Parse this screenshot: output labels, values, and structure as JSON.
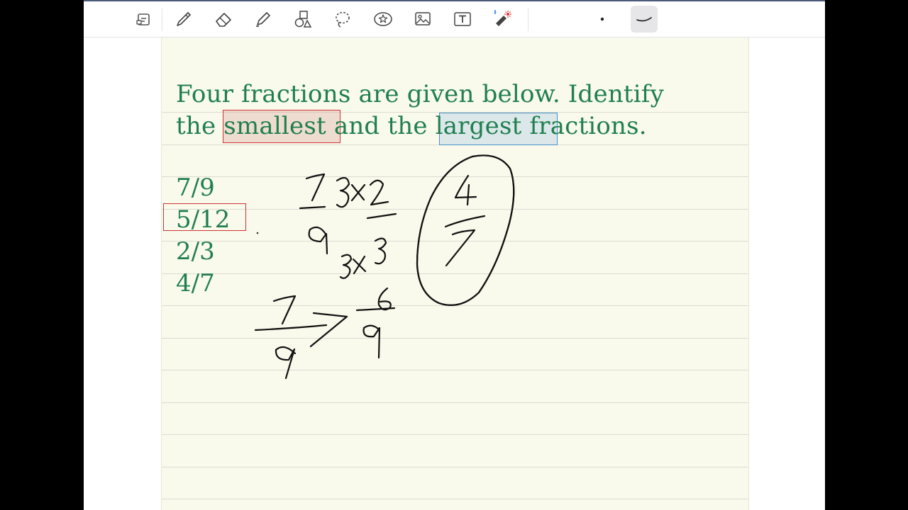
{
  "toolbar": {
    "tools": [
      {
        "name": "page-layout-icon",
        "label": "Page layout"
      },
      {
        "name": "pen-icon",
        "label": "Pen"
      },
      {
        "name": "eraser-icon",
        "label": "Eraser"
      },
      {
        "name": "highlighter-icon",
        "label": "Highlighter"
      },
      {
        "name": "shapes-icon",
        "label": "Shapes"
      },
      {
        "name": "lasso-icon",
        "label": "Lasso"
      },
      {
        "name": "sticker-icon",
        "label": "Sticker"
      },
      {
        "name": "image-icon",
        "label": "Image"
      },
      {
        "name": "text-box-icon",
        "label": "Text"
      },
      {
        "name": "laser-pointer-icon",
        "label": "Laser pointer"
      },
      {
        "name": "pen-size-dot-icon",
        "label": "Pen size"
      },
      {
        "name": "stroke-style-icon",
        "label": "Stroke style"
      }
    ],
    "active_tool": "stroke-style-icon"
  },
  "note": {
    "question_line1": "Four fractions are given below. Identify",
    "question_line2_before": "the ",
    "question_smallest": "smallest",
    "question_middle": " and the ",
    "question_largest": "largest",
    "question_end": " fractions.",
    "fractions": [
      "7/9",
      "5/12",
      "2/3",
      "4/7"
    ],
    "colors": {
      "text": "#1f7f50",
      "smallest_highlight": "#d03434",
      "largest_highlight": "#4a90c8",
      "circle": "#e0101e",
      "page": "#f9f9ec"
    }
  }
}
